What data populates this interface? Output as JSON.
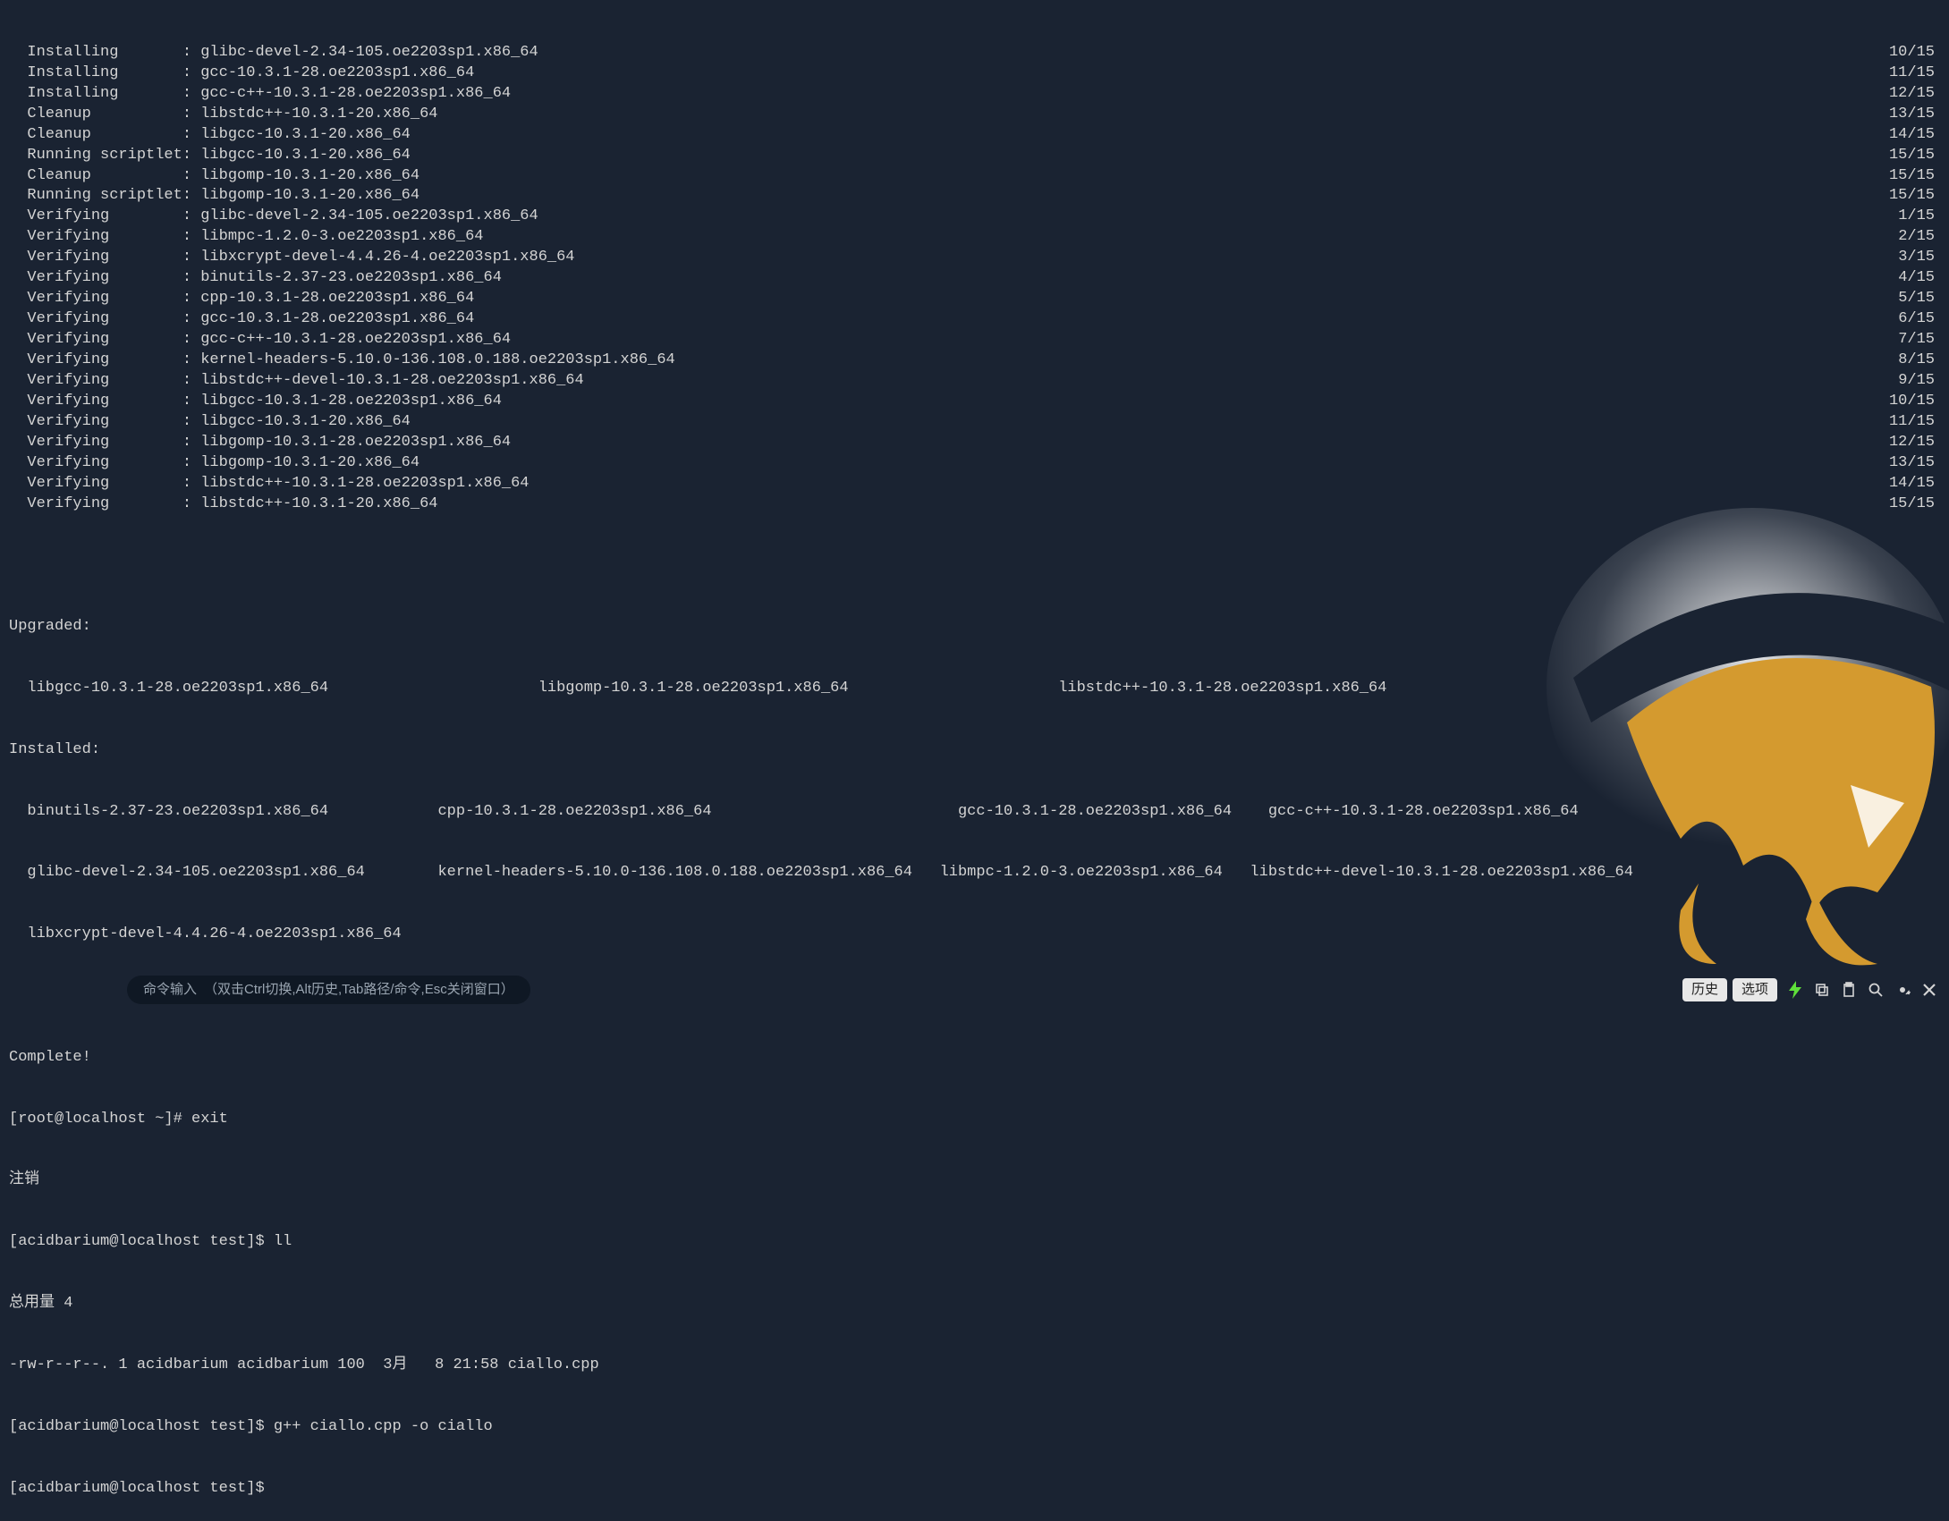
{
  "lines": [
    {
      "left": "  Installing       : glibc-devel-2.34-105.oe2203sp1.x86_64",
      "right": "10/15"
    },
    {
      "left": "  Installing       : gcc-10.3.1-28.oe2203sp1.x86_64",
      "right": "11/15"
    },
    {
      "left": "  Installing       : gcc-c++-10.3.1-28.oe2203sp1.x86_64",
      "right": "12/15"
    },
    {
      "left": "  Cleanup          : libstdc++-10.3.1-20.x86_64",
      "right": "13/15"
    },
    {
      "left": "  Cleanup          : libgcc-10.3.1-20.x86_64",
      "right": "14/15"
    },
    {
      "left": "  Running scriptlet: libgcc-10.3.1-20.x86_64",
      "right": "15/15"
    },
    {
      "left": "  Cleanup          : libgomp-10.3.1-20.x86_64",
      "right": "15/15"
    },
    {
      "left": "  Running scriptlet: libgomp-10.3.1-20.x86_64",
      "right": "15/15"
    },
    {
      "left": "  Verifying        : glibc-devel-2.34-105.oe2203sp1.x86_64",
      "right": "1/15"
    },
    {
      "left": "  Verifying        : libmpc-1.2.0-3.oe2203sp1.x86_64",
      "right": "2/15"
    },
    {
      "left": "  Verifying        : libxcrypt-devel-4.4.26-4.oe2203sp1.x86_64",
      "right": "3/15"
    },
    {
      "left": "  Verifying        : binutils-2.37-23.oe2203sp1.x86_64",
      "right": "4/15"
    },
    {
      "left": "  Verifying        : cpp-10.3.1-28.oe2203sp1.x86_64",
      "right": "5/15"
    },
    {
      "left": "  Verifying        : gcc-10.3.1-28.oe2203sp1.x86_64",
      "right": "6/15"
    },
    {
      "left": "  Verifying        : gcc-c++-10.3.1-28.oe2203sp1.x86_64",
      "right": "7/15"
    },
    {
      "left": "  Verifying        : kernel-headers-5.10.0-136.108.0.188.oe2203sp1.x86_64",
      "right": "8/15"
    },
    {
      "left": "  Verifying        : libstdc++-devel-10.3.1-28.oe2203sp1.x86_64",
      "right": "9/15"
    },
    {
      "left": "  Verifying        : libgcc-10.3.1-28.oe2203sp1.x86_64",
      "right": "10/15"
    },
    {
      "left": "  Verifying        : libgcc-10.3.1-20.x86_64",
      "right": "11/15"
    },
    {
      "left": "  Verifying        : libgomp-10.3.1-28.oe2203sp1.x86_64",
      "right": "12/15"
    },
    {
      "left": "  Verifying        : libgomp-10.3.1-20.x86_64",
      "right": "13/15"
    },
    {
      "left": "  Verifying        : libstdc++-10.3.1-28.oe2203sp1.x86_64",
      "right": "14/15"
    },
    {
      "left": "  Verifying        : libstdc++-10.3.1-20.x86_64",
      "right": "15/15"
    }
  ],
  "sections": {
    "upgraded_label": "Upgraded:",
    "upgraded_row": "  libgcc-10.3.1-28.oe2203sp1.x86_64                       libgomp-10.3.1-28.oe2203sp1.x86_64                       libstdc++-10.3.1-28.oe2203sp1.x86_64",
    "installed_label": "Installed:",
    "installed_row1": "  binutils-2.37-23.oe2203sp1.x86_64            cpp-10.3.1-28.oe2203sp1.x86_64                           gcc-10.3.1-28.oe2203sp1.x86_64    gcc-c++-10.3.1-28.oe2203sp1.x86_64",
    "installed_row2": "  glibc-devel-2.34-105.oe2203sp1.x86_64        kernel-headers-5.10.0-136.108.0.188.oe2203sp1.x86_64   libmpc-1.2.0-3.oe2203sp1.x86_64   libstdc++-devel-10.3.1-28.oe2203sp1.x86_64",
    "installed_row3": "  libxcrypt-devel-4.4.26-4.oe2203sp1.x86_64",
    "complete": "Complete!",
    "prompt_exit": "[root@localhost ~]# exit",
    "logout": "注销",
    "prompt_ll": "[acidbarium@localhost test]$ ll",
    "total": "总用量 4",
    "ls_line": "-rw-r--r--. 1 acidbarium acidbarium 100  3月   8 21:58 ciallo.cpp",
    "prompt_gpp": "[acidbarium@localhost test]$ g++ ciallo.cpp -o ciallo",
    "prompt_empty": "[acidbarium@localhost test]$"
  },
  "bottombar": {
    "cmd_label": "命令输入",
    "cmd_hint": "（双击Ctrl切换,Alt历史,Tab路径/命令,Esc关闭窗口）",
    "history_btn": "历史",
    "options_btn": "选项"
  }
}
